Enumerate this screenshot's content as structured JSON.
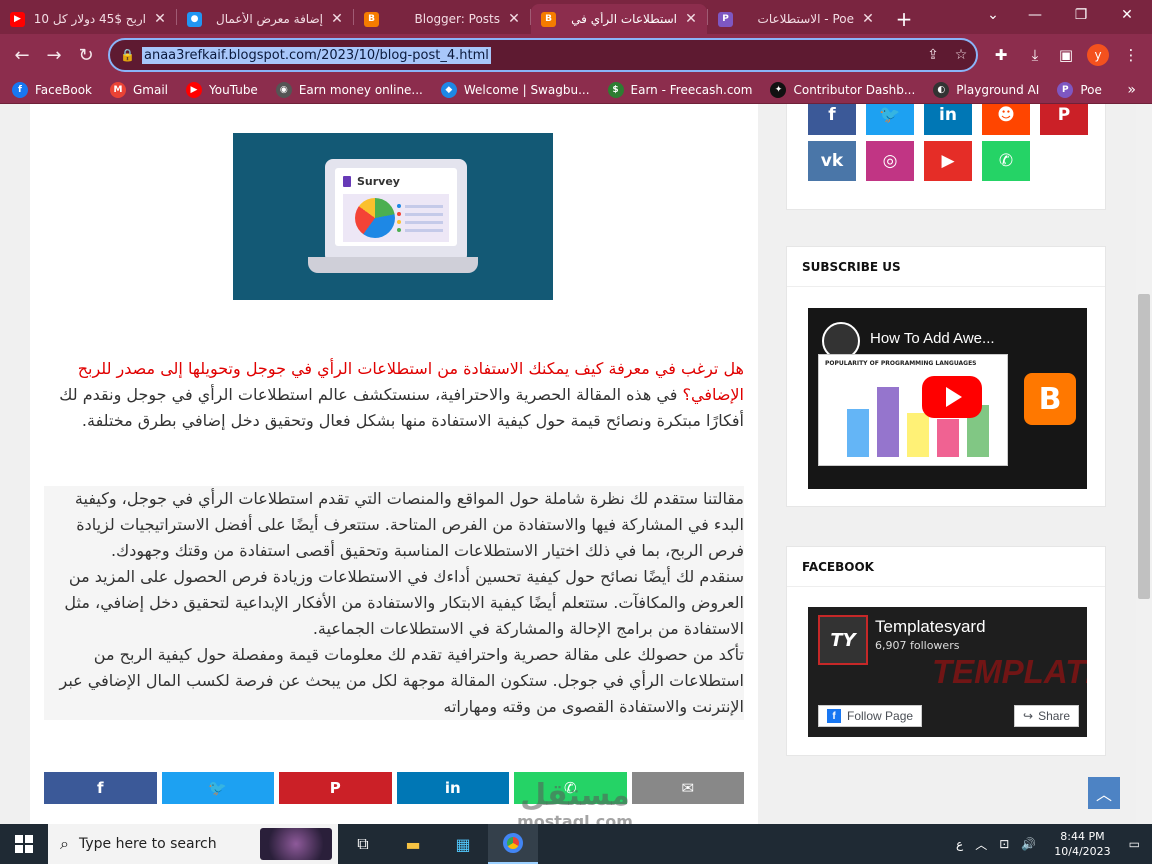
{
  "browser": {
    "tabs": [
      {
        "title": "اربح $45 دولار كل 10",
        "icon_color": "#ff0000",
        "icon_glyph": "▶"
      },
      {
        "title": "إضافة معرض الأعمال",
        "icon_color": "#2196f3",
        "icon_glyph": "●"
      },
      {
        "title": "Blogger: Posts",
        "icon_color": "#f57c00",
        "icon_glyph": "B"
      },
      {
        "title": "استطلاعات الرأي في",
        "icon_color": "#f57c00",
        "icon_glyph": "B"
      },
      {
        "title": "Poe - الاستطلاعات",
        "icon_color": "#7e57c2",
        "icon_glyph": "P"
      }
    ],
    "url": "anaa3refkaif.blogspot.com/2023/10/blog-post_4.html",
    "profile_initial": "y",
    "bookmarks": [
      {
        "label": "FaceBook",
        "color": "#1877f2",
        "glyph": "f"
      },
      {
        "label": "Gmail",
        "color": "#ea4335",
        "glyph": "M"
      },
      {
        "label": "YouTube",
        "color": "#ff0000",
        "glyph": "▶"
      },
      {
        "label": "Earn money online...",
        "color": "#555555",
        "glyph": "◉"
      },
      {
        "label": "Welcome | Swagbu...",
        "color": "#1e88e5",
        "glyph": "◆"
      },
      {
        "label": "Earn - Freecash.com",
        "color": "#2e7d32",
        "glyph": "$"
      },
      {
        "label": "Contributor Dashb...",
        "color": "#111111",
        "glyph": "✦"
      },
      {
        "label": "Playground AI",
        "color": "#333333",
        "glyph": "◐"
      },
      {
        "label": "Poe",
        "color": "#7e57c2",
        "glyph": "P"
      }
    ]
  },
  "article": {
    "survey_label": "Survey",
    "lead_red": "هل ترغب في معرفة كيف يمكنك الاستفادة من استطلاعات الرأي في جوجل وتحويلها إلى مصدر للربح الإضافي؟",
    "lead_rest": "في هذه المقالة الحصرية والاحترافية، سنستكشف عالم استطلاعات الرأي في جوجل ونقدم لك أفكارًا مبتكرة ونصائح قيمة حول كيفية الاستفادة منها بشكل فعال وتحقيق دخل إضافي بطرق مختلفة.",
    "para1": "مقالتنا ستقدم لك نظرة شاملة حول المواقع والمنصات التي تقدم استطلاعات الرأي في جوجل، وكيفية البدء في المشاركة فيها والاستفادة من الفرص المتاحة. ستتعرف أيضًا على أفضل الاستراتيجيات لزيادة فرص الربح، بما في ذلك اختيار الاستطلاعات المناسبة وتحقيق أقصى استفادة من وقتك وجهودك.",
    "para2": "سنقدم لك أيضًا نصائح حول كيفية تحسين أداءك في الاستطلاعات وزيادة فرص الحصول على المزيد من العروض والمكافآت. ستتعلم أيضًا كيفية الابتكار والاستفادة من الأفكار الإبداعية لتحقيق دخل إضافي، مثل الاستفادة من برامج الإحالة والمشاركة في الاستطلاعات الجماعية.",
    "para3": "تأكد من حصولك على مقالة حصرية واحترافية تقدم لك معلومات قيمة ومفصلة حول كيفية الربح من استطلاعات الرأي في جوجل. ستكون المقالة موجهة لكل من يبحث عن فرصة لكسب المال الإضافي عبر الإنترنت والاستفادة القصوى من وقته ومهاراته"
  },
  "share_buttons": [
    {
      "name": "facebook",
      "glyph": "f",
      "color": "#3b5998"
    },
    {
      "name": "twitter",
      "glyph": "🐦",
      "color": "#1da1f2"
    },
    {
      "name": "pinterest",
      "glyph": "P",
      "color": "#cb2027"
    },
    {
      "name": "linkedin",
      "glyph": "in",
      "color": "#0077b5"
    },
    {
      "name": "whatsapp",
      "glyph": "✆",
      "color": "#25d366"
    },
    {
      "name": "email",
      "glyph": "✉",
      "color": "#888888"
    }
  ],
  "sidebar": {
    "social": [
      {
        "name": "facebook",
        "glyph": "f",
        "color": "#3b5998"
      },
      {
        "name": "twitter",
        "glyph": "🐦",
        "color": "#1da1f2"
      },
      {
        "name": "linkedin",
        "glyph": "in",
        "color": "#0077b5"
      },
      {
        "name": "reddit",
        "glyph": "☻",
        "color": "#ff4500"
      },
      {
        "name": "pinterest",
        "glyph": "P",
        "color": "#cb2027"
      },
      {
        "name": "vk",
        "glyph": "vk",
        "color": "#4a76a8"
      },
      {
        "name": "instagram",
        "glyph": "◎",
        "color": "#c13584"
      },
      {
        "name": "youtube",
        "glyph": "▶",
        "color": "#e52d27"
      },
      {
        "name": "whatsapp",
        "glyph": "✆",
        "color": "#25d366"
      }
    ],
    "subscribe_title": "SUBSCRIBE US",
    "video_title": "How To Add Awe...",
    "video_chart_caption": "POPULARITY OF PROGRAMMING LANGUAGES",
    "facebook_title": "FACEBOOK",
    "fb_page_name": "Templatesyard",
    "fb_followers": "6,907 followers",
    "fb_follow_label": "Follow Page",
    "fb_share_label": "Share",
    "fb_banner": "TEMPLATES YARD",
    "fb_logo": "TY"
  },
  "watermark": {
    "arabic": "مستقل",
    "latin": "mostaql.com"
  },
  "taskbar": {
    "search_placeholder": "Type here to search",
    "time": "8:44 PM",
    "date": "10/4/2023",
    "lang": "ع"
  }
}
